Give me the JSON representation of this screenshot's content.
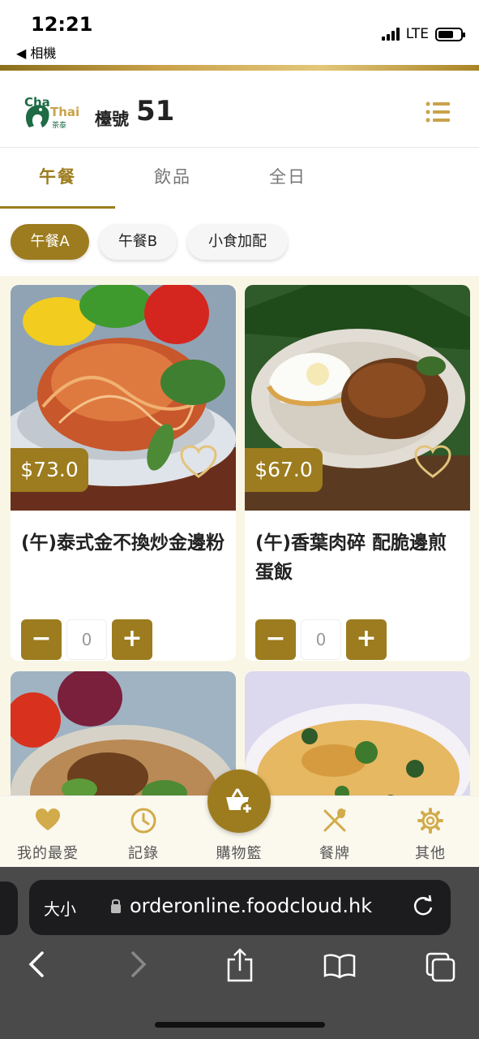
{
  "status": {
    "time": "12:21",
    "back_label": "◀ 相機",
    "network": "LTE"
  },
  "header": {
    "table_label": "檯號",
    "table_number": "51",
    "logo_text_1": "Cha",
    "logo_text_2": "Thai",
    "logo_text_3": "茶泰"
  },
  "tabs": [
    {
      "label": "午餐",
      "active": true
    },
    {
      "label": "飲品",
      "active": false
    },
    {
      "label": "全日",
      "active": false
    }
  ],
  "subcategories": [
    {
      "label": "午餐A",
      "active": true
    },
    {
      "label": "午餐B",
      "active": false
    },
    {
      "label": "小食加配",
      "active": false
    }
  ],
  "products": [
    {
      "name": "(午)泰式金不換炒金邊粉",
      "price": "$73.0",
      "quantity": "0",
      "favorited": false
    },
    {
      "name": "(午)香葉肉碎 配脆邊煎蛋飯",
      "price": "$67.0",
      "quantity": "0",
      "favorited": false
    }
  ],
  "qty_buttons": {
    "minus": "−",
    "plus": "+"
  },
  "bottom_nav": [
    {
      "label": "我的最愛",
      "icon": "heart-icon"
    },
    {
      "label": "記錄",
      "icon": "clock-icon"
    },
    {
      "label": "購物籃",
      "icon": "basket-icon"
    },
    {
      "label": "餐牌",
      "icon": "utensils-icon"
    },
    {
      "label": "其他",
      "icon": "gear-icon"
    }
  ],
  "browser": {
    "text_size_label": "大小",
    "url": "orderonline.foodcloud.hk"
  },
  "colors": {
    "accent": "#9c7c1e",
    "background_tint": "#faf6e6"
  }
}
